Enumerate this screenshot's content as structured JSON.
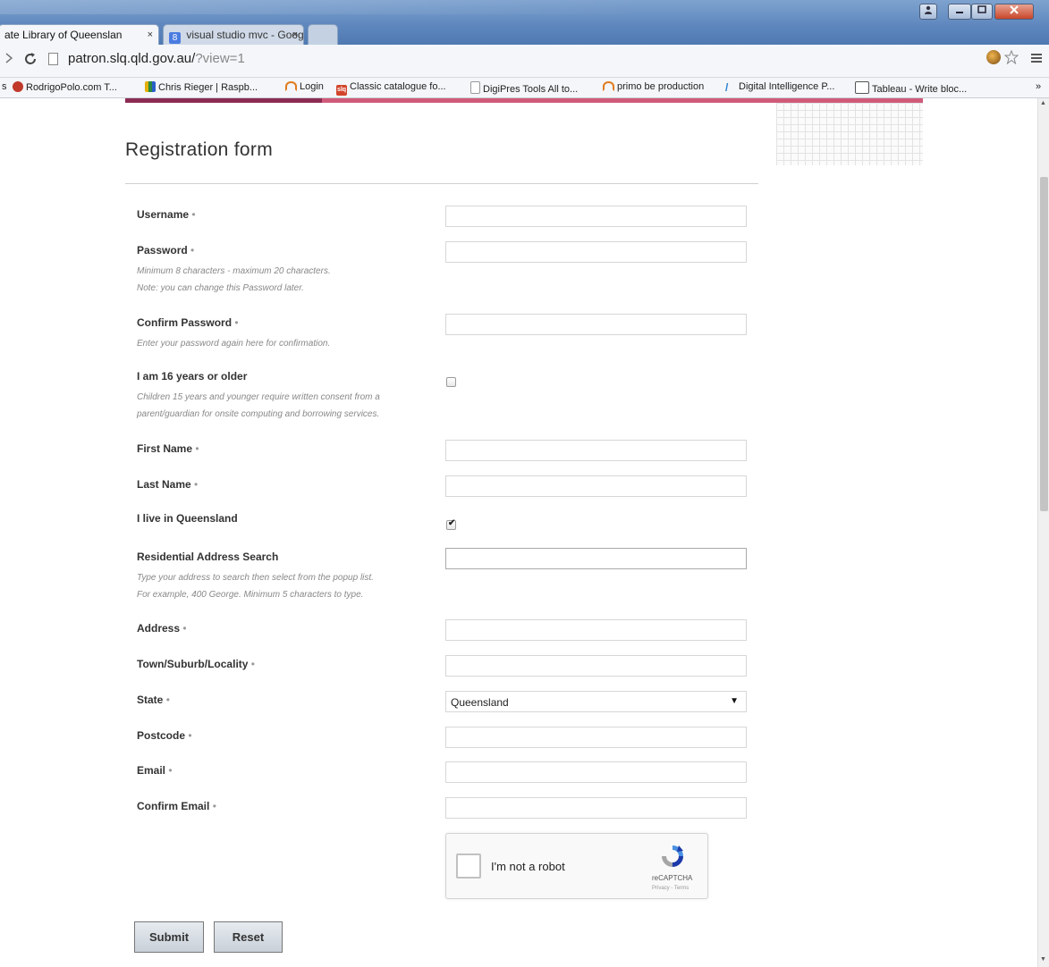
{
  "browser": {
    "tabs": [
      {
        "label": "ate Library of Queenslan",
        "close": "×"
      },
      {
        "label": "visual studio mvc - Googl",
        "close": "×"
      }
    ],
    "google_favicon": "8",
    "url_host": "patron.slq.qld.gov.au/",
    "url_query": "?view=1",
    "bookmarks": [
      {
        "label": "s",
        "icon_color": ""
      },
      {
        "label": "RodrigoPolo.com T...",
        "icon_color": "#c0392b"
      },
      {
        "label": "Chris Rieger | Raspb...",
        "icon_color": "#e2b007"
      },
      {
        "label": "Login",
        "icon_color": "#e07b1f"
      },
      {
        "label": "Classic catalogue fo...",
        "icon_color": "#d2452b",
        "icon_text": "slq"
      },
      {
        "label": "DigiPres Tools All to...",
        "icon_color": "#ffffff"
      },
      {
        "label": "primo be production",
        "icon_color": "#e07b1f"
      },
      {
        "label": "Digital Intelligence P...",
        "icon_color": "#2a7fd1"
      },
      {
        "label": "Tableau - Write bloc...",
        "icon_color": "#ffffff"
      }
    ],
    "bookmarks_overflow": "»"
  },
  "form": {
    "title": "Registration form",
    "required_marker": "•",
    "fields": {
      "username": {
        "label": "Username",
        "value": ""
      },
      "password": {
        "label": "Password",
        "help1": "Minimum 8 characters - maximum 20 characters.",
        "help2": "Note: you can change this Password later.",
        "value": ""
      },
      "confirm_password": {
        "label": "Confirm Password",
        "help1": "Enter your password again here for confirmation.",
        "value": ""
      },
      "age": {
        "label": "I am 16 years or older",
        "help1": "Children 15 years and younger require written consent from a",
        "help2": "parent/guardian for onsite computing and borrowing services.",
        "checked": false
      },
      "first_name": {
        "label": "First Name",
        "value": ""
      },
      "last_name": {
        "label": "Last Name",
        "value": ""
      },
      "queensland": {
        "label": "I live in Queensland",
        "checked": true,
        "tick": "✔"
      },
      "address_search": {
        "label": "Residential Address Search",
        "help1": "Type your address to search then select from the popup list.",
        "help2": "For example, 400 George. Minimum 5 characters to type.",
        "value": ""
      },
      "address": {
        "label": "Address",
        "value": ""
      },
      "town": {
        "label": "Town/Suburb/Locality",
        "value": ""
      },
      "state": {
        "label": "State",
        "selected": "Queensland",
        "arrow": "▼"
      },
      "postcode": {
        "label": "Postcode",
        "value": ""
      },
      "email": {
        "label": "Email",
        "value": ""
      },
      "confirm_email": {
        "label": "Confirm Email",
        "value": ""
      }
    },
    "recaptcha": {
      "label": "I'm not a robot",
      "brand": "reCAPTCHA",
      "terms": "Privacy - Terms"
    },
    "buttons": {
      "submit": "Submit",
      "reset": "Reset"
    }
  }
}
